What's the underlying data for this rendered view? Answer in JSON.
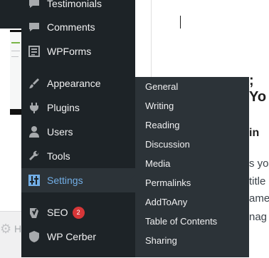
{
  "menu": {
    "items": [
      {
        "label": "Testimonials",
        "icon": "testimonials-icon"
      },
      {
        "label": "Comments",
        "icon": "comment-icon"
      },
      {
        "label": "WPForms",
        "icon": "form-icon"
      },
      {
        "label": "Appearance",
        "icon": "paintbrush-icon"
      },
      {
        "label": "Plugins",
        "icon": "plugin-icon"
      },
      {
        "label": "Users",
        "icon": "user-icon"
      },
      {
        "label": "Tools",
        "icon": "wrench-icon"
      },
      {
        "label": "Settings",
        "icon": "settings-icon",
        "active": true
      },
      {
        "label": "SEO",
        "icon": "yoast-icon",
        "badge": "2"
      },
      {
        "label": "WP Cerber",
        "icon": "cerber-icon"
      }
    ]
  },
  "submenu": {
    "items": [
      "General",
      "Writing",
      "Reading",
      "Discussion",
      "Media",
      "Permalinks",
      "AddToAny",
      "Table of Contents",
      "Sharing"
    ]
  },
  "editor": {
    "heading_fragment": "; Yo",
    "subheading_fragment": "in",
    "text_lines": [
      "s yo",
      "title",
      "ame",
      "nag"
    ]
  },
  "background": {
    "bottom_fragment": "H"
  },
  "colors": {
    "menu_bg": "#1d2327",
    "submenu_bg": "#2c3338",
    "active_text": "#72aee6",
    "badge": "#d63638"
  }
}
